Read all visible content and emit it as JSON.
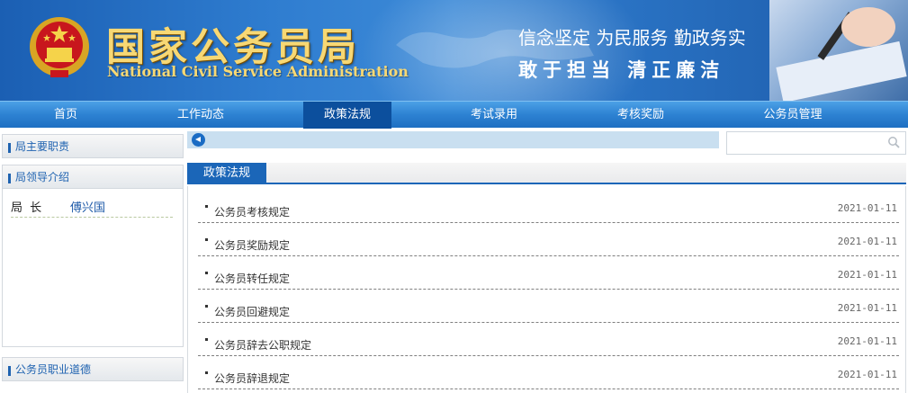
{
  "header": {
    "title_cn": "国家公务员局",
    "title_en": "National Civil Service Administration",
    "slogan_line1": "信念坚定  为民服务  勤政务实",
    "slogan_line2": "敢于担当   清正廉洁",
    "emblem_icon": "national-emblem-icon",
    "colors": {
      "bg": "#2f7dd0",
      "title": "#f7d874"
    }
  },
  "nav": {
    "items": [
      {
        "label": "首页"
      },
      {
        "label": "工作动态"
      },
      {
        "label": "政策法规",
        "active": true
      },
      {
        "label": "考试录用"
      },
      {
        "label": "考核奖励"
      },
      {
        "label": "公务员管理"
      }
    ],
    "colors": {
      "bar": "#2d82d2",
      "active": "#0c4f9d"
    }
  },
  "sidebar": {
    "sections": [
      {
        "label": "局主要职责"
      },
      {
        "label": "局领导介绍"
      },
      {
        "label": "公务员职业道德"
      }
    ],
    "leader": {
      "role": "局 长",
      "name": "傅兴国"
    }
  },
  "search": {
    "placeholder": "",
    "icon": "search-icon",
    "strip_icon": "play-icon"
  },
  "panel": {
    "tab_label": "政策法规",
    "items": [
      {
        "title": "公务员考核规定",
        "date": "2021-01-11"
      },
      {
        "title": "公务员奖励规定",
        "date": "2021-01-11"
      },
      {
        "title": "公务员转任规定",
        "date": "2021-01-11"
      },
      {
        "title": "公务员回避规定",
        "date": "2021-01-11"
      },
      {
        "title": "公务员辞去公职规定",
        "date": "2021-01-11"
      },
      {
        "title": "公务员辞退规定",
        "date": "2021-01-11"
      }
    ]
  }
}
